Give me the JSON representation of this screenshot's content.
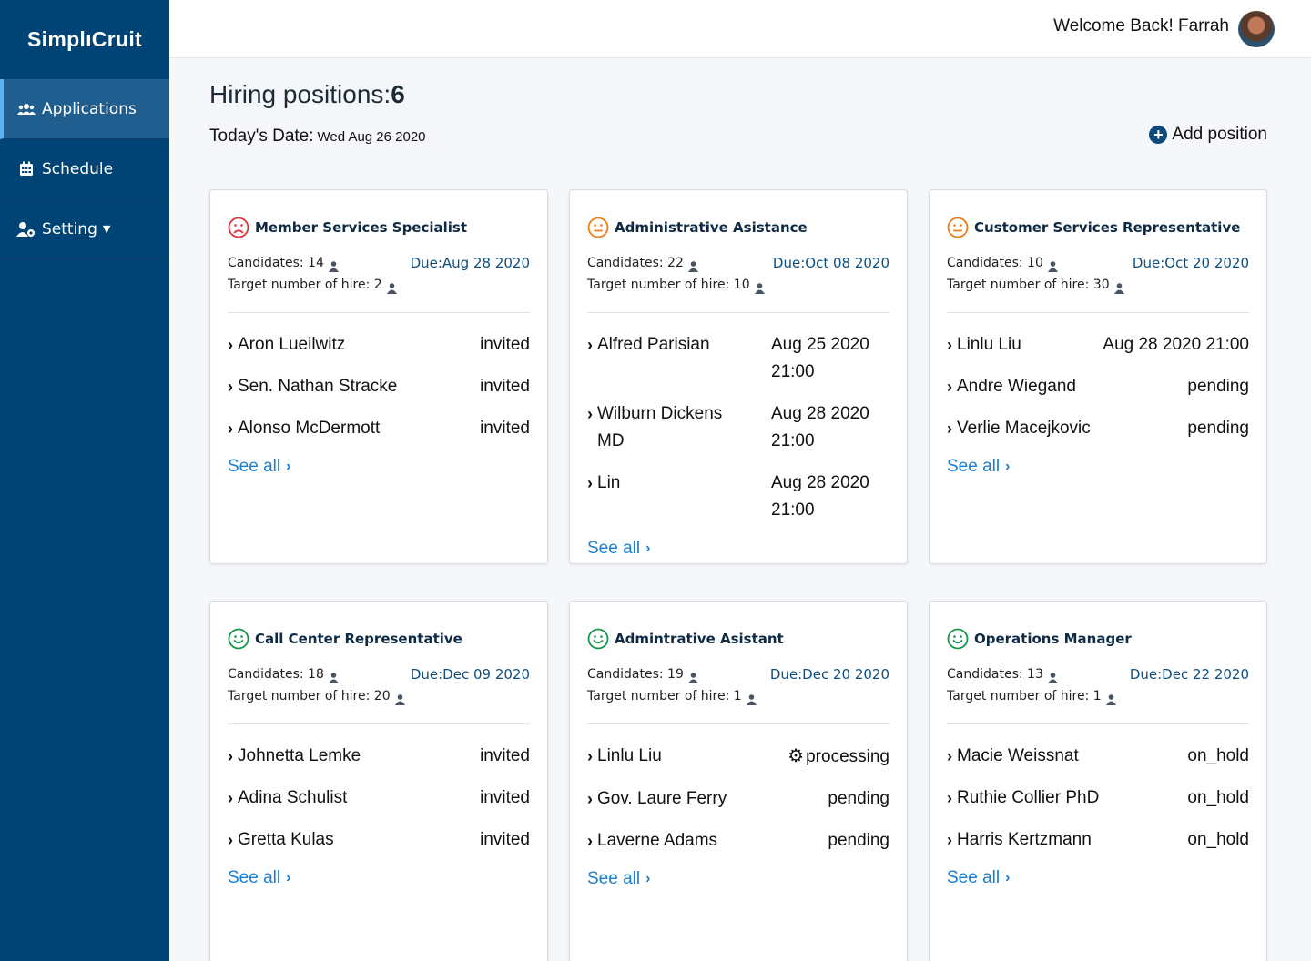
{
  "app": {
    "logo": "SimplıCruit"
  },
  "sidebar": {
    "items": [
      {
        "label": "Applications",
        "icon": "users-icon",
        "active": true
      },
      {
        "label": "Schedule",
        "icon": "calendar-icon",
        "active": false
      },
      {
        "label": "Setting",
        "icon": "user-cog-icon",
        "active": false
      }
    ]
  },
  "header": {
    "welcome": "Welcome Back! Farrah"
  },
  "main": {
    "heading_prefix": "Hiring positions:",
    "heading_count": "6",
    "date_label": "Today's Date:",
    "date_value": "Wed Aug 26 2020",
    "add_position_label": "Add position",
    "see_all_label": "See all"
  },
  "colors": {
    "sad": "#e0323a",
    "neutral": "#ee7d13",
    "happy": "#16964a",
    "sidebar": "#004475",
    "link": "#1a7fd1"
  },
  "positions": [
    {
      "title": "Member Services Specialist",
      "mood": "sad",
      "candidates": "Candidates: 14",
      "target": "Target number of hire: 2",
      "due": "Due:Aug 28 2020",
      "list": [
        {
          "name": "Aron Lueilwitz",
          "status": "invited"
        },
        {
          "name": "Sen. Nathan Stracke",
          "status": "invited"
        },
        {
          "name": "Alonso McDermott",
          "status": "invited"
        }
      ]
    },
    {
      "title": "Administrative Asistance",
      "mood": "neutral",
      "candidates": "Candidates: 22",
      "target": "Target number of hire: 10",
      "due": "Due:Oct 08 2020",
      "list": [
        {
          "name": "Alfred Parisian",
          "status": "Aug 25 2020 21:00"
        },
        {
          "name": "Wilburn Dickens MD",
          "status": "Aug 28 2020 21:00"
        },
        {
          "name": "Lin",
          "status": "Aug 28 2020 21:00"
        }
      ]
    },
    {
      "title": "Customer Services Representative",
      "mood": "neutral",
      "candidates": "Candidates: 10",
      "target": "Target number of hire: 30",
      "due": "Due:Oct 20 2020",
      "list": [
        {
          "name": "Linlu Liu",
          "status": "Aug 28 2020 21:00"
        },
        {
          "name": "Andre Wiegand",
          "status": "pending"
        },
        {
          "name": "Verlie Macejkovic",
          "status": "pending"
        }
      ]
    },
    {
      "title": "Call Center Representative",
      "mood": "happy",
      "candidates": "Candidates: 18",
      "target": "Target number of hire: 20",
      "due": "Due:Dec 09 2020",
      "list": [
        {
          "name": "Johnetta Lemke",
          "status": "invited"
        },
        {
          "name": "Adina Schulist",
          "status": "invited"
        },
        {
          "name": "Gretta Kulas",
          "status": "invited"
        }
      ]
    },
    {
      "title": "Admintrative Asistant",
      "mood": "happy",
      "candidates": "Candidates: 19",
      "target": "Target number of hire: 1",
      "due": "Due:Dec 20 2020",
      "list": [
        {
          "name": "Linlu Liu",
          "status": "processing"
        },
        {
          "name": "Gov. Laure Ferry",
          "status": "pending"
        },
        {
          "name": "Laverne Adams",
          "status": "pending"
        }
      ]
    },
    {
      "title": "Operations Manager",
      "mood": "happy",
      "candidates": "Candidates: 13",
      "target": "Target number of hire: 1",
      "due": "Due:Dec 22 2020",
      "list": [
        {
          "name": "Macie Weissnat",
          "status": "on_hold"
        },
        {
          "name": "Ruthie Collier PhD",
          "status": "on_hold"
        },
        {
          "name": "Harris Kertzmann",
          "status": "on_hold"
        }
      ]
    }
  ]
}
